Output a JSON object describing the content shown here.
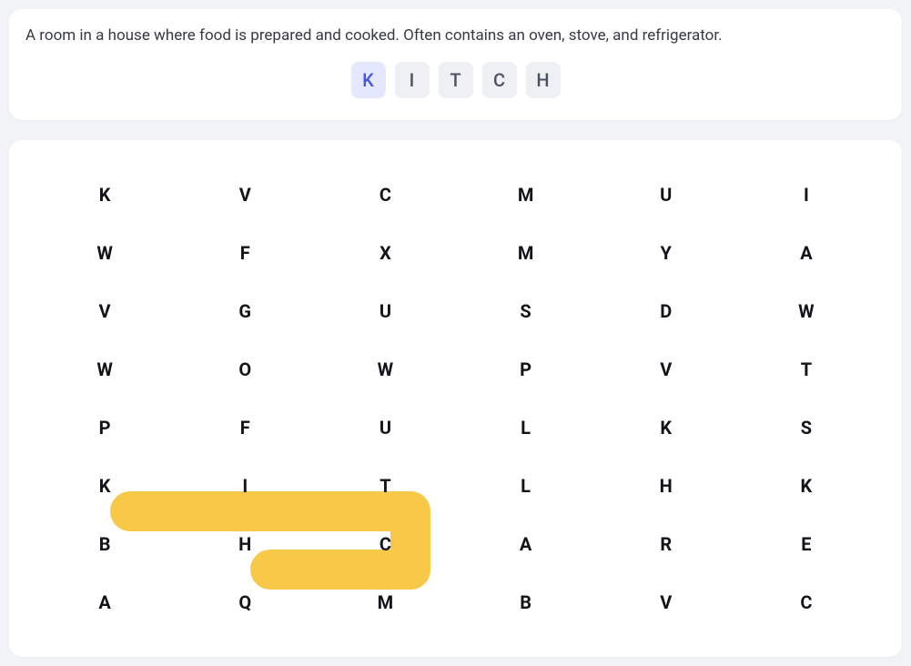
{
  "clue": {
    "text": "A room in a house where food is prepared and cooked. Often contains an oven, stove, and refrigerator.",
    "answer_tiles": [
      {
        "letter": "K",
        "active": true
      },
      {
        "letter": "I",
        "active": false
      },
      {
        "letter": "T",
        "active": false
      },
      {
        "letter": "C",
        "active": false
      },
      {
        "letter": "H",
        "active": false
      }
    ]
  },
  "grid": {
    "rows": 8,
    "cols": 6,
    "cells": [
      [
        "K",
        "V",
        "C",
        "M",
        "U",
        "I"
      ],
      [
        "W",
        "F",
        "X",
        "M",
        "Y",
        "A"
      ],
      [
        "V",
        "G",
        "U",
        "S",
        "D",
        "W"
      ],
      [
        "W",
        "O",
        "W",
        "P",
        "V",
        "T"
      ],
      [
        "P",
        "F",
        "U",
        "L",
        "K",
        "S"
      ],
      [
        "K",
        "I",
        "T",
        "L",
        "H",
        "K"
      ],
      [
        "B",
        "H",
        "C",
        "A",
        "R",
        "E"
      ],
      [
        "A",
        "Q",
        "M",
        "B",
        "V",
        "C"
      ]
    ],
    "highlighted": [
      {
        "row": 5,
        "col": 0
      },
      {
        "row": 5,
        "col": 1
      },
      {
        "row": 5,
        "col": 2
      },
      {
        "row": 6,
        "col": 2
      },
      {
        "row": 6,
        "col": 1
      }
    ]
  }
}
